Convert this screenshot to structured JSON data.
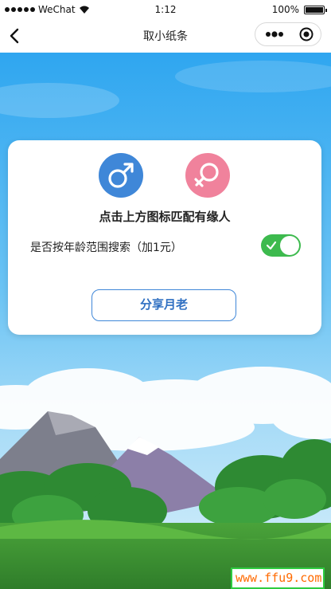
{
  "status_bar": {
    "carrier": "WeChat",
    "time": "1:12",
    "battery": "100%"
  },
  "nav": {
    "title": "取小纸条",
    "back_icon": "chevron-left-icon",
    "more_icon": "more-dots-icon",
    "close_icon": "target-close-icon"
  },
  "card": {
    "male_icon": "male-symbol-icon",
    "female_icon": "female-symbol-icon",
    "headline": "点击上方图标匹配有缘人",
    "age_option_label": "是否按年龄范围搜索（加1元）",
    "age_option_on": true,
    "share_button": "分享月老"
  },
  "watermark": {
    "text": "www.ffu9.com"
  },
  "colors": {
    "male": "#3f87d8",
    "female": "#f0829c",
    "toggle_on": "#3dba4e",
    "sky": "#33a9f2",
    "accent": "#2f6fc2"
  }
}
